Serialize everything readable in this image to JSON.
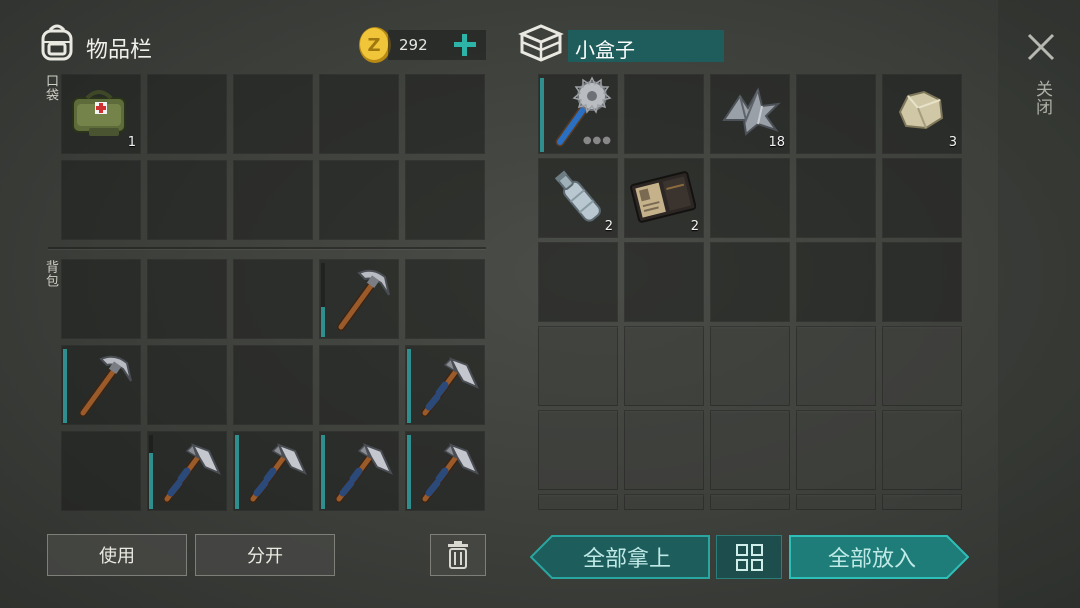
{
  "left_panel": {
    "title": "物品栏",
    "pocket_label": "口袋",
    "backpack_label": "背包",
    "coins": "292",
    "pocket_slots": [
      {
        "item": "first-aid-bag-icon",
        "count": "1",
        "durability": null
      },
      {
        "item": null
      },
      {
        "item": null
      },
      {
        "item": null
      },
      {
        "item": null
      },
      {
        "item": null
      },
      {
        "item": null
      },
      {
        "item": null
      },
      {
        "item": null
      },
      {
        "item": null
      }
    ],
    "backpack_slots": [
      {
        "item": null
      },
      {
        "item": null
      },
      {
        "item": null
      },
      {
        "item": "pickaxe-icon",
        "durability": 0.4
      },
      {
        "item": null
      },
      {
        "item": "pickaxe-icon",
        "durability": 1.0
      },
      {
        "item": null
      },
      {
        "item": null
      },
      {
        "item": null
      },
      {
        "item": "hatchet-icon",
        "durability": 1.0
      },
      {
        "item": null
      },
      {
        "item": "hatchet-icon",
        "durability": 0.75
      },
      {
        "item": "hatchet-icon",
        "durability": 1.0
      },
      {
        "item": "hatchet-icon",
        "durability": 1.0
      },
      {
        "item": "hatchet-icon",
        "durability": 1.0
      }
    ],
    "buttons": {
      "use": "使用",
      "split": "分开"
    }
  },
  "right_panel": {
    "container_name": "小盒子",
    "close_label": "关闭",
    "slots": [
      {
        "item": "spiked-club-icon",
        "durability": 1.0
      },
      {
        "item": null
      },
      {
        "item": "metal-scrap-icon",
        "count": "18"
      },
      {
        "item": null
      },
      {
        "item": "stone-icon",
        "count": "3"
      },
      {
        "item": "water-bottle-icon",
        "count": "2"
      },
      {
        "item": "wallet-icon",
        "count": "2"
      }
    ],
    "buttons": {
      "take_all": "全部拿上",
      "put_all": "全部放入"
    }
  },
  "colors": {
    "teal_accent": "#1e9a9a",
    "teal_dark": "#1b5f5e",
    "durability": "#2f8f8f",
    "coin": "#e0b62a"
  }
}
